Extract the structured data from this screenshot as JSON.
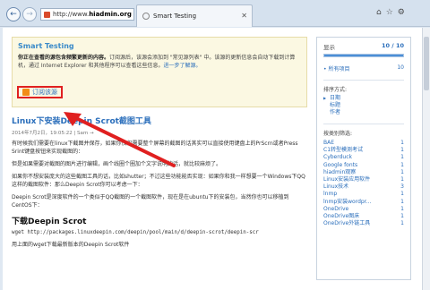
{
  "browser": {
    "url_prefix": "http://www.",
    "url_domain": "hiadmin.org",
    "tab_title": "Smart Testing",
    "back_label": "←",
    "forward_label": "→"
  },
  "notice": {
    "title": "Smart Testing",
    "body_strong": "你正在查看的源包含频繁更新的内容。",
    "body_rest": "订阅源后，该源会添加到 \"常见源列表\" 中。该源的更新信息会自动下载到计算机，通过 Internet Explorer 和其他程序可以查看这些信息。",
    "learn_more": "进一步了解源。",
    "subscribe_label": "订阅该源"
  },
  "post": {
    "title": "Linux下安装Deepin Scrot截图工具",
    "meta": "2014年7月2日，19:05:22 | Sam →",
    "para1": "有时候我们需要在linux下截图并保存，如果你仅仅需要整个屏幕的截图的话其实可以直接使用键盘上的PrScrn或者Press Srint键盘按钮来实现截图的：",
    "para2": "但是如果需要对截图的图片进行编辑，画个线圈个圈加个文字说明的话，就比较麻烦了。",
    "para3": "如果你不想安装庞大的这些截图工具的话，比如shutter；不过这些功能能否实现：如果你和我一样想要一个Windows下QQ这样的截图软件：那么Deepin Scrot你可以考虑一下：",
    "para4": "Deepin Scrot是深度软件的一个类似于QQ截图的一个截图软件，现在是在ubuntu下的安装包，当然你也可以移植到CentOS下：",
    "h2": "下载Deepin Scrot",
    "code": "wget http://packages.linuxdeepin.com/deepin/pool/main/d/deepin-scrot/deepin-scr",
    "para5": "用上面的wget下载最新版本的Deepin Scrot软件"
  },
  "feed_panel": {
    "display_label": "显示",
    "display_count": "10 / 10",
    "progress": 1.0,
    "all_items_label": "所有项目",
    "all_items_count": "10",
    "sort_label": "排序方式:",
    "sort_options": [
      "日期",
      "标题",
      "作者"
    ],
    "filter_label": "按类别筛选:",
    "categories": [
      {
        "name": "BAE",
        "count": "1"
      },
      {
        "name": "C1转型模测考试",
        "count": "1"
      },
      {
        "name": "Cyberduck",
        "count": "1"
      },
      {
        "name": "Google fonts",
        "count": "1"
      },
      {
        "name": "hiadmin观察",
        "count": "1"
      },
      {
        "name": "Linux安装应用软件",
        "count": "1"
      },
      {
        "name": "Linux技术",
        "count": "3"
      },
      {
        "name": "lnmp",
        "count": "1"
      },
      {
        "name": "lnmp安装wordpr...",
        "count": "1"
      },
      {
        "name": "OneDrive",
        "count": "1"
      },
      {
        "name": "OneDrive图床",
        "count": "1"
      },
      {
        "name": "OneDrive外链工具",
        "count": "1"
      }
    ]
  },
  "colors": {
    "link": "#2a6ebb",
    "highlight": "#e02020",
    "notice_bg": "#fbf8e2"
  }
}
